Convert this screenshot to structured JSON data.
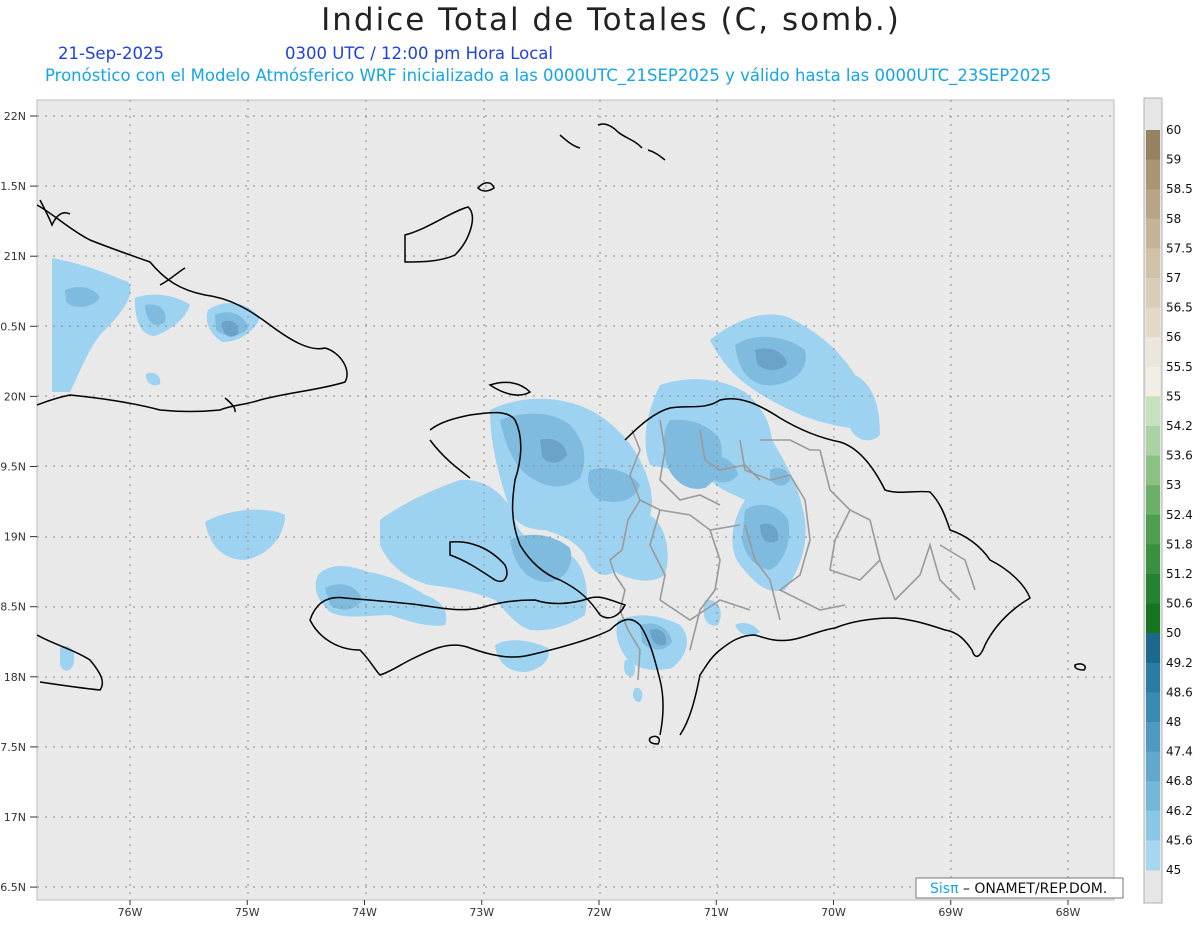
{
  "title": "Indice Total de Totales (C, somb.)",
  "subtitle": {
    "date": "21-Sep-2025",
    "time": "0300 UTC / 12:00 pm Hora Local",
    "model": "Pronóstico con el Modelo Atmósferico WRF inicializado a las 0000UTC_21SEP2025 y válido hasta las  0000UTC_23SEP2025"
  },
  "axes": {
    "lat_labels": [
      "22N",
      "1.5N",
      "21N",
      "0.5N",
      "20N",
      "9.5N",
      "19N",
      "8.5N",
      "18N",
      "7.5N",
      "17N",
      "6.5N"
    ],
    "lon_labels": [
      "76W",
      "75W",
      "74W",
      "73W",
      "72W",
      "71W",
      "70W",
      "69W",
      "68W"
    ]
  },
  "colorbar": {
    "labels": [
      "60",
      "59",
      "58.5",
      "58",
      "57.5",
      "57",
      "56.5",
      "56",
      "55.5",
      "55",
      "54.2",
      "53.6",
      "53",
      "52.4",
      "51.8",
      "51.2",
      "50.6",
      "50",
      "49.2",
      "48.6",
      "48",
      "47.4",
      "46.8",
      "46.2",
      "45.6",
      "45"
    ],
    "colors": [
      "#968260",
      "#a99474",
      "#b9a486",
      "#c5b396",
      "#d0c2a7",
      "#dacdb8",
      "#e3d9c8",
      "#ede6da",
      "#f3eee4",
      "#c7e3bd",
      "#aad2a2",
      "#8bc184",
      "#6caf67",
      "#4f9e4f",
      "#37913e",
      "#238333",
      "#16751f",
      "#1b6a8b",
      "#2b7ba4",
      "#3a8ab2",
      "#4d9ac0",
      "#60a9cd",
      "#74b8d9",
      "#8ac7e4",
      "#a6d7f0"
    ]
  },
  "credit": {
    "brand": "Sisπ",
    "org": " – ONAMET/REP.DOM."
  },
  "colors": {
    "map_background": "#e9e9e9",
    "coastline": "#000000",
    "province_border": "#9a9a9a",
    "shade_light": "#9dd3f0",
    "shade_mid": "#7fbbdf",
    "shade_dark": "#6aa2c8"
  }
}
